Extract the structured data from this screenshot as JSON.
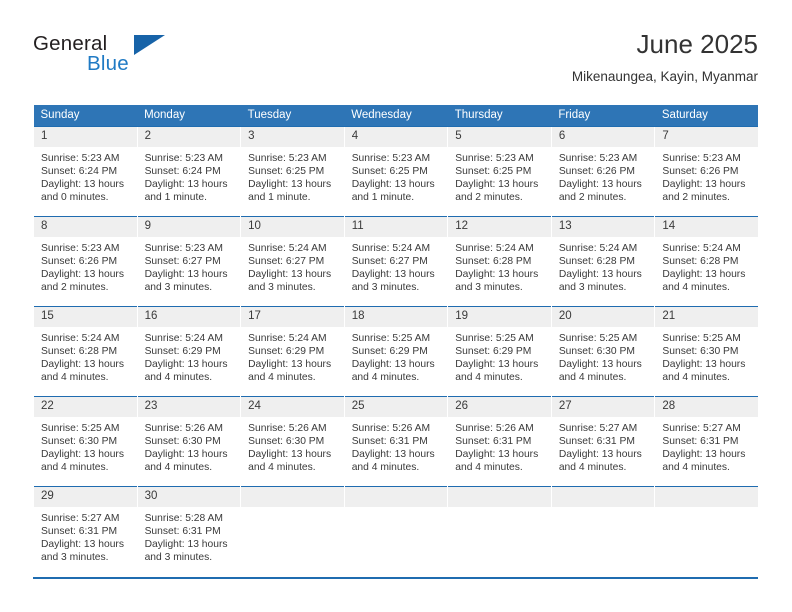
{
  "brand": {
    "line1": "General",
    "line2": "Blue",
    "logo_icon": "triangle-logo-icon",
    "accent_color": "#1f7ac4"
  },
  "header": {
    "title": "June 2025",
    "subtitle": "Mikenaungea, Kayin, Myanmar"
  },
  "theme": {
    "header_bg": "#2e75b6",
    "row_rule": "#1f6cb0",
    "day_num_bg": "#efefef"
  },
  "calendar": {
    "weekday_headers": [
      "Sunday",
      "Monday",
      "Tuesday",
      "Wednesday",
      "Thursday",
      "Friday",
      "Saturday"
    ],
    "weeks": [
      [
        {
          "day": "1",
          "sunrise": "Sunrise: 5:23 AM",
          "sunset": "Sunset: 6:24 PM",
          "daylight": "Daylight: 13 hours and 0 minutes."
        },
        {
          "day": "2",
          "sunrise": "Sunrise: 5:23 AM",
          "sunset": "Sunset: 6:24 PM",
          "daylight": "Daylight: 13 hours and 1 minute."
        },
        {
          "day": "3",
          "sunrise": "Sunrise: 5:23 AM",
          "sunset": "Sunset: 6:25 PM",
          "daylight": "Daylight: 13 hours and 1 minute."
        },
        {
          "day": "4",
          "sunrise": "Sunrise: 5:23 AM",
          "sunset": "Sunset: 6:25 PM",
          "daylight": "Daylight: 13 hours and 1 minute."
        },
        {
          "day": "5",
          "sunrise": "Sunrise: 5:23 AM",
          "sunset": "Sunset: 6:25 PM",
          "daylight": "Daylight: 13 hours and 2 minutes."
        },
        {
          "day": "6",
          "sunrise": "Sunrise: 5:23 AM",
          "sunset": "Sunset: 6:26 PM",
          "daylight": "Daylight: 13 hours and 2 minutes."
        },
        {
          "day": "7",
          "sunrise": "Sunrise: 5:23 AM",
          "sunset": "Sunset: 6:26 PM",
          "daylight": "Daylight: 13 hours and 2 minutes."
        }
      ],
      [
        {
          "day": "8",
          "sunrise": "Sunrise: 5:23 AM",
          "sunset": "Sunset: 6:26 PM",
          "daylight": "Daylight: 13 hours and 2 minutes."
        },
        {
          "day": "9",
          "sunrise": "Sunrise: 5:23 AM",
          "sunset": "Sunset: 6:27 PM",
          "daylight": "Daylight: 13 hours and 3 minutes."
        },
        {
          "day": "10",
          "sunrise": "Sunrise: 5:24 AM",
          "sunset": "Sunset: 6:27 PM",
          "daylight": "Daylight: 13 hours and 3 minutes."
        },
        {
          "day": "11",
          "sunrise": "Sunrise: 5:24 AM",
          "sunset": "Sunset: 6:27 PM",
          "daylight": "Daylight: 13 hours and 3 minutes."
        },
        {
          "day": "12",
          "sunrise": "Sunrise: 5:24 AM",
          "sunset": "Sunset: 6:28 PM",
          "daylight": "Daylight: 13 hours and 3 minutes."
        },
        {
          "day": "13",
          "sunrise": "Sunrise: 5:24 AM",
          "sunset": "Sunset: 6:28 PM",
          "daylight": "Daylight: 13 hours and 3 minutes."
        },
        {
          "day": "14",
          "sunrise": "Sunrise: 5:24 AM",
          "sunset": "Sunset: 6:28 PM",
          "daylight": "Daylight: 13 hours and 4 minutes."
        }
      ],
      [
        {
          "day": "15",
          "sunrise": "Sunrise: 5:24 AM",
          "sunset": "Sunset: 6:28 PM",
          "daylight": "Daylight: 13 hours and 4 minutes."
        },
        {
          "day": "16",
          "sunrise": "Sunrise: 5:24 AM",
          "sunset": "Sunset: 6:29 PM",
          "daylight": "Daylight: 13 hours and 4 minutes."
        },
        {
          "day": "17",
          "sunrise": "Sunrise: 5:24 AM",
          "sunset": "Sunset: 6:29 PM",
          "daylight": "Daylight: 13 hours and 4 minutes."
        },
        {
          "day": "18",
          "sunrise": "Sunrise: 5:25 AM",
          "sunset": "Sunset: 6:29 PM",
          "daylight": "Daylight: 13 hours and 4 minutes."
        },
        {
          "day": "19",
          "sunrise": "Sunrise: 5:25 AM",
          "sunset": "Sunset: 6:29 PM",
          "daylight": "Daylight: 13 hours and 4 minutes."
        },
        {
          "day": "20",
          "sunrise": "Sunrise: 5:25 AM",
          "sunset": "Sunset: 6:30 PM",
          "daylight": "Daylight: 13 hours and 4 minutes."
        },
        {
          "day": "21",
          "sunrise": "Sunrise: 5:25 AM",
          "sunset": "Sunset: 6:30 PM",
          "daylight": "Daylight: 13 hours and 4 minutes."
        }
      ],
      [
        {
          "day": "22",
          "sunrise": "Sunrise: 5:25 AM",
          "sunset": "Sunset: 6:30 PM",
          "daylight": "Daylight: 13 hours and 4 minutes."
        },
        {
          "day": "23",
          "sunrise": "Sunrise: 5:26 AM",
          "sunset": "Sunset: 6:30 PM",
          "daylight": "Daylight: 13 hours and 4 minutes."
        },
        {
          "day": "24",
          "sunrise": "Sunrise: 5:26 AM",
          "sunset": "Sunset: 6:30 PM",
          "daylight": "Daylight: 13 hours and 4 minutes."
        },
        {
          "day": "25",
          "sunrise": "Sunrise: 5:26 AM",
          "sunset": "Sunset: 6:31 PM",
          "daylight": "Daylight: 13 hours and 4 minutes."
        },
        {
          "day": "26",
          "sunrise": "Sunrise: 5:26 AM",
          "sunset": "Sunset: 6:31 PM",
          "daylight": "Daylight: 13 hours and 4 minutes."
        },
        {
          "day": "27",
          "sunrise": "Sunrise: 5:27 AM",
          "sunset": "Sunset: 6:31 PM",
          "daylight": "Daylight: 13 hours and 4 minutes."
        },
        {
          "day": "28",
          "sunrise": "Sunrise: 5:27 AM",
          "sunset": "Sunset: 6:31 PM",
          "daylight": "Daylight: 13 hours and 4 minutes."
        }
      ],
      [
        {
          "day": "29",
          "sunrise": "Sunrise: 5:27 AM",
          "sunset": "Sunset: 6:31 PM",
          "daylight": "Daylight: 13 hours and 3 minutes."
        },
        {
          "day": "30",
          "sunrise": "Sunrise: 5:28 AM",
          "sunset": "Sunset: 6:31 PM",
          "daylight": "Daylight: 13 hours and 3 minutes."
        },
        {
          "day": "",
          "sunrise": "",
          "sunset": "",
          "daylight": ""
        },
        {
          "day": "",
          "sunrise": "",
          "sunset": "",
          "daylight": ""
        },
        {
          "day": "",
          "sunrise": "",
          "sunset": "",
          "daylight": ""
        },
        {
          "day": "",
          "sunrise": "",
          "sunset": "",
          "daylight": ""
        },
        {
          "day": "",
          "sunrise": "",
          "sunset": "",
          "daylight": ""
        }
      ]
    ]
  }
}
